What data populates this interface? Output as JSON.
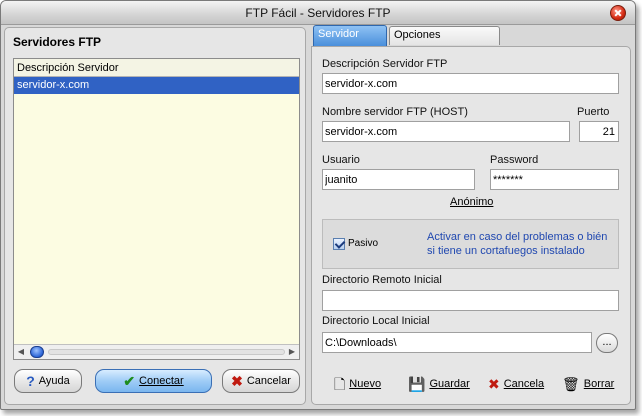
{
  "window": {
    "title": "FTP Fácil - Servidores FTP"
  },
  "left": {
    "title": "Servidores FTP",
    "list_header": "Descripción Servidor",
    "rows": [
      "servidor-x.com"
    ],
    "buttons": {
      "help": "Ayuda",
      "connect": "Conectar",
      "cancel": "Cancelar"
    }
  },
  "tabs": [
    "Servidor FTP",
    "Opciones Avanzadas"
  ],
  "form": {
    "description_label": "Descripción Servidor FTP",
    "description_value": "servidor-x.com",
    "host_label": "Nombre servidor FTP (HOST)",
    "host_value": "servidor-x.com",
    "port_label": "Puerto",
    "port_value": "21",
    "user_label": "Usuario",
    "user_value": "juanito",
    "password_label": "Password",
    "password_value": "*******",
    "anonymous_label": "Anónimo",
    "passive_label": "Pasivo",
    "passive_hint": "Activar en caso del problemas o bién si tiene un cortafuegos instalado",
    "remote_dir_label": "Directorio Remoto Inicial",
    "remote_dir_value": "",
    "local_dir_label": "Directorio Local Inicial",
    "local_dir_value": "C:\\Downloads\\",
    "browse_label": "..."
  },
  "actions": {
    "new": "Nuevo",
    "save": "Guardar",
    "cancel": "Cancela",
    "delete": "Borrar"
  },
  "colors": {
    "selection": "#3062c4",
    "list_bg": "#fcfce2",
    "hint_text": "#2048b0",
    "active_tab": "#4a8fdb"
  }
}
